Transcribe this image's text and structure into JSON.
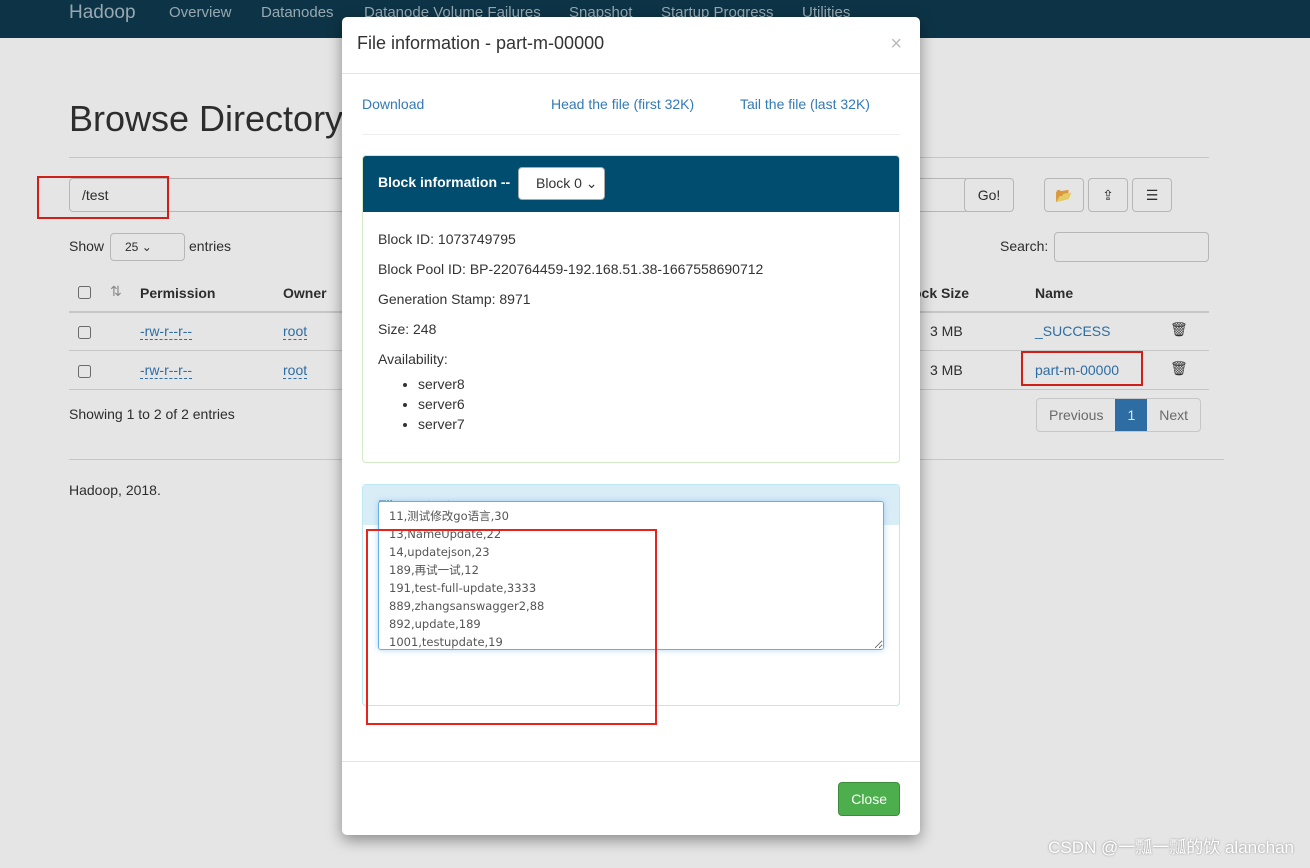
{
  "nav": {
    "brand": "Hadoop",
    "items": [
      "Overview",
      "Datanodes",
      "Datanode Volume Failures",
      "Snapshot",
      "Startup Progress",
      "Utilities"
    ]
  },
  "page": {
    "title": "Browse Directory",
    "path": "/test",
    "go": "Go!",
    "show": "Show",
    "entries_value": "25",
    "entries": "entries",
    "search": "Search:",
    "columns": [
      "Permission",
      "Owner",
      "ock Size",
      "Name"
    ],
    "rows": [
      {
        "perm": "-rw-r--r--",
        "owner": "root",
        "size": "3 MB",
        "name": "_SUCCESS"
      },
      {
        "perm": "-rw-r--r--",
        "owner": "root",
        "size": "3 MB",
        "name": "part-m-00000"
      }
    ],
    "showing": "Showing 1 to 2 of 2 entries",
    "prev": "Previous",
    "page": "1",
    "next": "Next",
    "footer": "Hadoop, 2018."
  },
  "modal": {
    "title": "File information - part-m-00000",
    "download": "Download",
    "head": "Head the file (first 32K)",
    "tail": "Tail the file (last 32K)",
    "block_label": "Block information --",
    "block_select": "Block 0",
    "block_id": "Block ID: 1073749795",
    "pool_id": "Block Pool ID: BP-220764459-192.168.51.38-1667558690712",
    "gen": "Generation Stamp: 8971",
    "size": "Size: 248",
    "avail": "Availability:",
    "servers": [
      "server8",
      "server6",
      "server7"
    ],
    "contents_title": "File contents",
    "contents": "11,测试修改go语言,30\n13,NameUpdate,22\n14,updatejson,23\n189,再试一试,12\n191,test-full-update,3333\n889,zhangsanswagger2,88\n892,update,189\n1001,testupdate,19",
    "close": "Close"
  },
  "watermark": "CSDN @一瓢一瓢的饮 alanchan"
}
